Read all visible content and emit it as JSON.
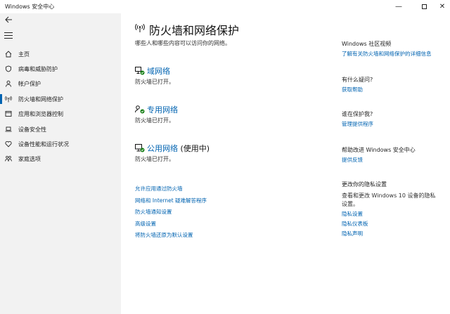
{
  "window": {
    "title": "Windows 安全中心",
    "minimize": "—",
    "close": "✕"
  },
  "sidebar": {
    "items": [
      {
        "label": "主页",
        "icon": "home-icon"
      },
      {
        "label": "病毒和威胁防护",
        "icon": "shield-icon"
      },
      {
        "label": "帐户保护",
        "icon": "person-icon"
      },
      {
        "label": "防火墙和网络保护",
        "icon": "wifi-antenna-icon",
        "active": true
      },
      {
        "label": "应用和浏览器控制",
        "icon": "app-window-icon"
      },
      {
        "label": "设备安全性",
        "icon": "laptop-icon"
      },
      {
        "label": "设备性能和运行状况",
        "icon": "heart-icon"
      },
      {
        "label": "家庭选项",
        "icon": "family-icon"
      }
    ]
  },
  "main": {
    "title": "防火墙和网络保护",
    "subtitle": "哪些人和哪些内容可以访问你的网络。",
    "networks": [
      {
        "name": "域网络",
        "status": "防火墙已打开。",
        "in_use": ""
      },
      {
        "name": "专用网络",
        "status": "防火墙已打开。",
        "in_use": ""
      },
      {
        "name": "公用网络",
        "status": "防火墙已打开。",
        "in_use": " (使用中)"
      }
    ],
    "links": [
      "允许应用通过防火墙",
      "网络和 Internet 疑难解答程序",
      "防火墙通知设置",
      "高级设置",
      "将防火墙还原为默认设置"
    ]
  },
  "aside": {
    "community_heading": "Windows 社区视频",
    "community_link": "了解有关防火墙和网络保护的详细信息",
    "question_heading": "有什么疑问?",
    "question_link": "获取帮助",
    "protect_heading": "谁在保护我?",
    "protect_link": "管理提供程序",
    "improve_heading": "帮助改进 Windows 安全中心",
    "improve_link": "提供反馈",
    "privacy_heading": "更改你的隐私设置",
    "privacy_text": "查看和更改 Windows 10 设备的隐私设置。",
    "privacy_links": [
      "隐私设置",
      "隐私仪表板",
      "隐私声明"
    ]
  },
  "colors": {
    "accent": "#0063b1",
    "sidebar_bg": "#f2f2f2",
    "status_ok": "#107c10"
  }
}
